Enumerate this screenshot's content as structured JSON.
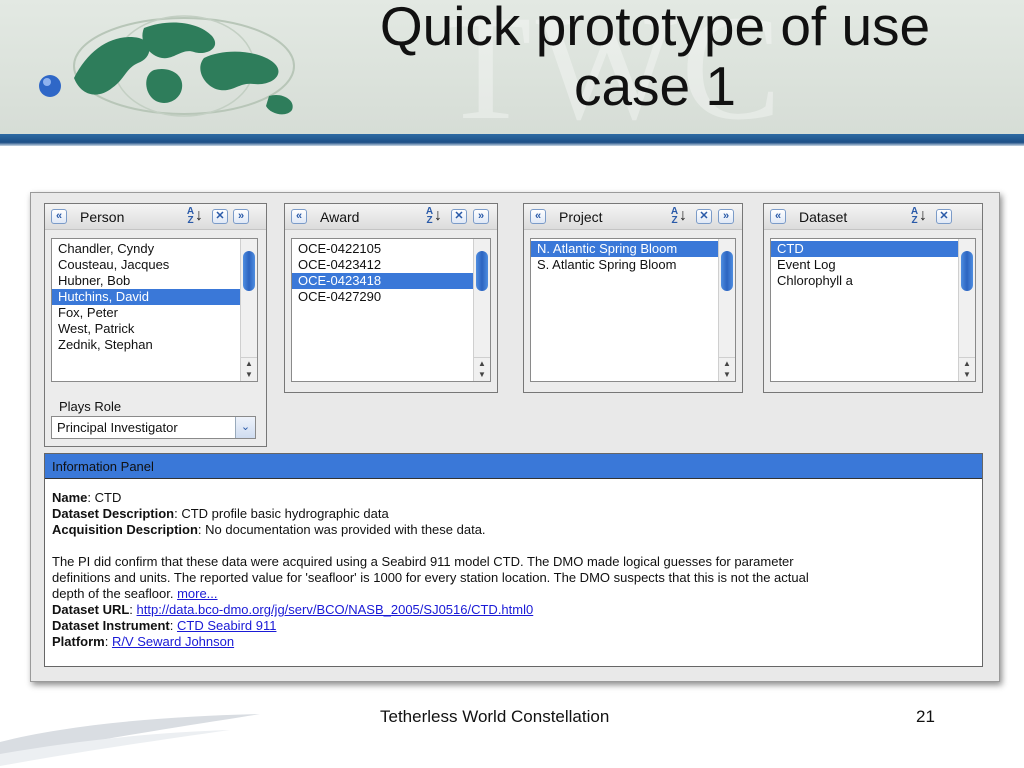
{
  "slide": {
    "title_line1": "Quick prototype of use",
    "title_line2": "case 1",
    "footer": "Tetherless World Constellation",
    "page_number": "21"
  },
  "facets": {
    "person": {
      "title": "Person",
      "items": [
        "Chandler, Cyndy",
        "Cousteau, Jacques",
        "Hubner, Bob",
        "Hutchins, David",
        "Fox, Peter",
        "West, Patrick",
        "Zednik, Stephan"
      ],
      "selected": "Hutchins, David",
      "role_label": "Plays Role",
      "role_value": "Principal Investigator"
    },
    "award": {
      "title": "Award",
      "items": [
        "OCE-0422105",
        "OCE-0423412",
        "OCE-0423418",
        "OCE-0427290"
      ],
      "selected": "OCE-0423418"
    },
    "project": {
      "title": "Project",
      "items": [
        "N. Atlantic Spring Bloom",
        "S. Atlantic Spring Bloom"
      ],
      "selected": "N. Atlantic Spring Bloom"
    },
    "dataset": {
      "title": "Dataset",
      "items": [
        "CTD",
        "Event Log",
        "Chlorophyll a"
      ],
      "selected": "CTD"
    }
  },
  "info_panel": {
    "title": "Information Panel",
    "name_label": "Name",
    "name_value": "CTD",
    "dataset_desc_label": "Dataset Description",
    "dataset_desc_value": "CTD profile basic hydrographic data",
    "acq_desc_label": "Acquisition Description",
    "acq_desc_value": "No documentation was provided with these data.",
    "para_line1": "The PI did confirm that these data were acquired using a Seabird 911 model CTD.  The DMO made logical guesses for parameter",
    "para_line2": "definitions and units.  The reported value for 'seafloor' is 1000 for every station location.  The DMO suspects that this is not the actual",
    "para_line3": "depth of the seafloor.",
    "more_link": "more...",
    "url_label": "Dataset URL",
    "url_value": "http://data.bco-dmo.org/jg/serv/BCO/NASB_2005/SJ0516/CTD.html0",
    "instrument_label": "Dataset Instrument",
    "instrument_value": "CTD Seabird 911",
    "platform_label": "Platform",
    "platform_value": "R/V Seward Johnson"
  },
  "icons": {
    "collapse_left": "«",
    "expand_right": "»",
    "close": "✕",
    "sort_az": "AZ↓",
    "dropdown": "chevron-down",
    "accent_color": "#3a78d8",
    "header_rule_color": "#1d4f86"
  }
}
